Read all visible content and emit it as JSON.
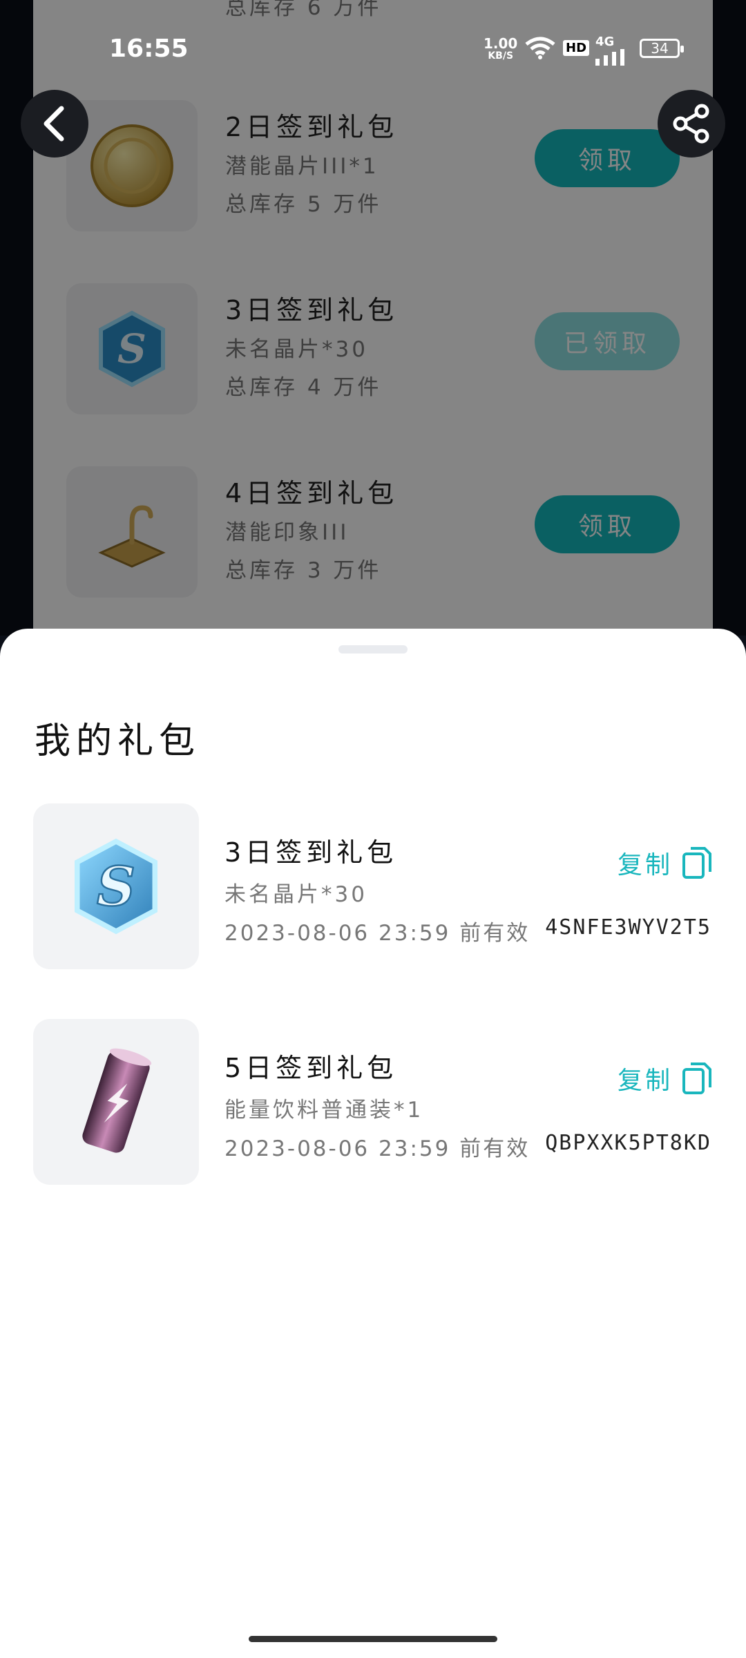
{
  "status": {
    "time": "16:55",
    "net_speed_top": "1.00",
    "net_speed_unit": "KB/S",
    "hd": "HD",
    "signal": "4G",
    "battery": "34"
  },
  "background_list": [
    {
      "title": "",
      "item": "",
      "stock": "总库存 6 万件",
      "button": "",
      "button_state": "partial"
    },
    {
      "title": "2日签到礼包",
      "item": "潜能晶片III*1",
      "stock": "总库存 5 万件",
      "button": "领取",
      "button_state": "active",
      "icon": "gold-coin-icon"
    },
    {
      "title": "3日签到礼包",
      "item": "未名晶片*30",
      "stock": "总库存 4 万件",
      "button": "已领取",
      "button_state": "done",
      "icon": "blue-hexagon-s-icon"
    },
    {
      "title": "4日签到礼包",
      "item": "潜能印象III",
      "stock": "总库存 3 万件",
      "button": "领取",
      "button_state": "active",
      "icon": "golden-hook-icon"
    }
  ],
  "sheet": {
    "title": "我的礼包",
    "gifts": [
      {
        "name": "3日签到礼包",
        "item": "未名晶片*30",
        "valid": "2023-08-06 23:59 前有效",
        "copy_label": "复制",
        "code": "4SNFE3WYV2T5",
        "icon": "blue-hexagon-s-icon"
      },
      {
        "name": "5日签到礼包",
        "item": "能量饮料普通装*1",
        "valid": "2023-08-06 23:59 前有效",
        "copy_label": "复制",
        "code": "QBPXXK5PT8KD",
        "icon": "energy-drink-can-icon"
      }
    ]
  },
  "colors": {
    "accent": "#14b8bd",
    "accent_done": "#8fe1e3"
  }
}
